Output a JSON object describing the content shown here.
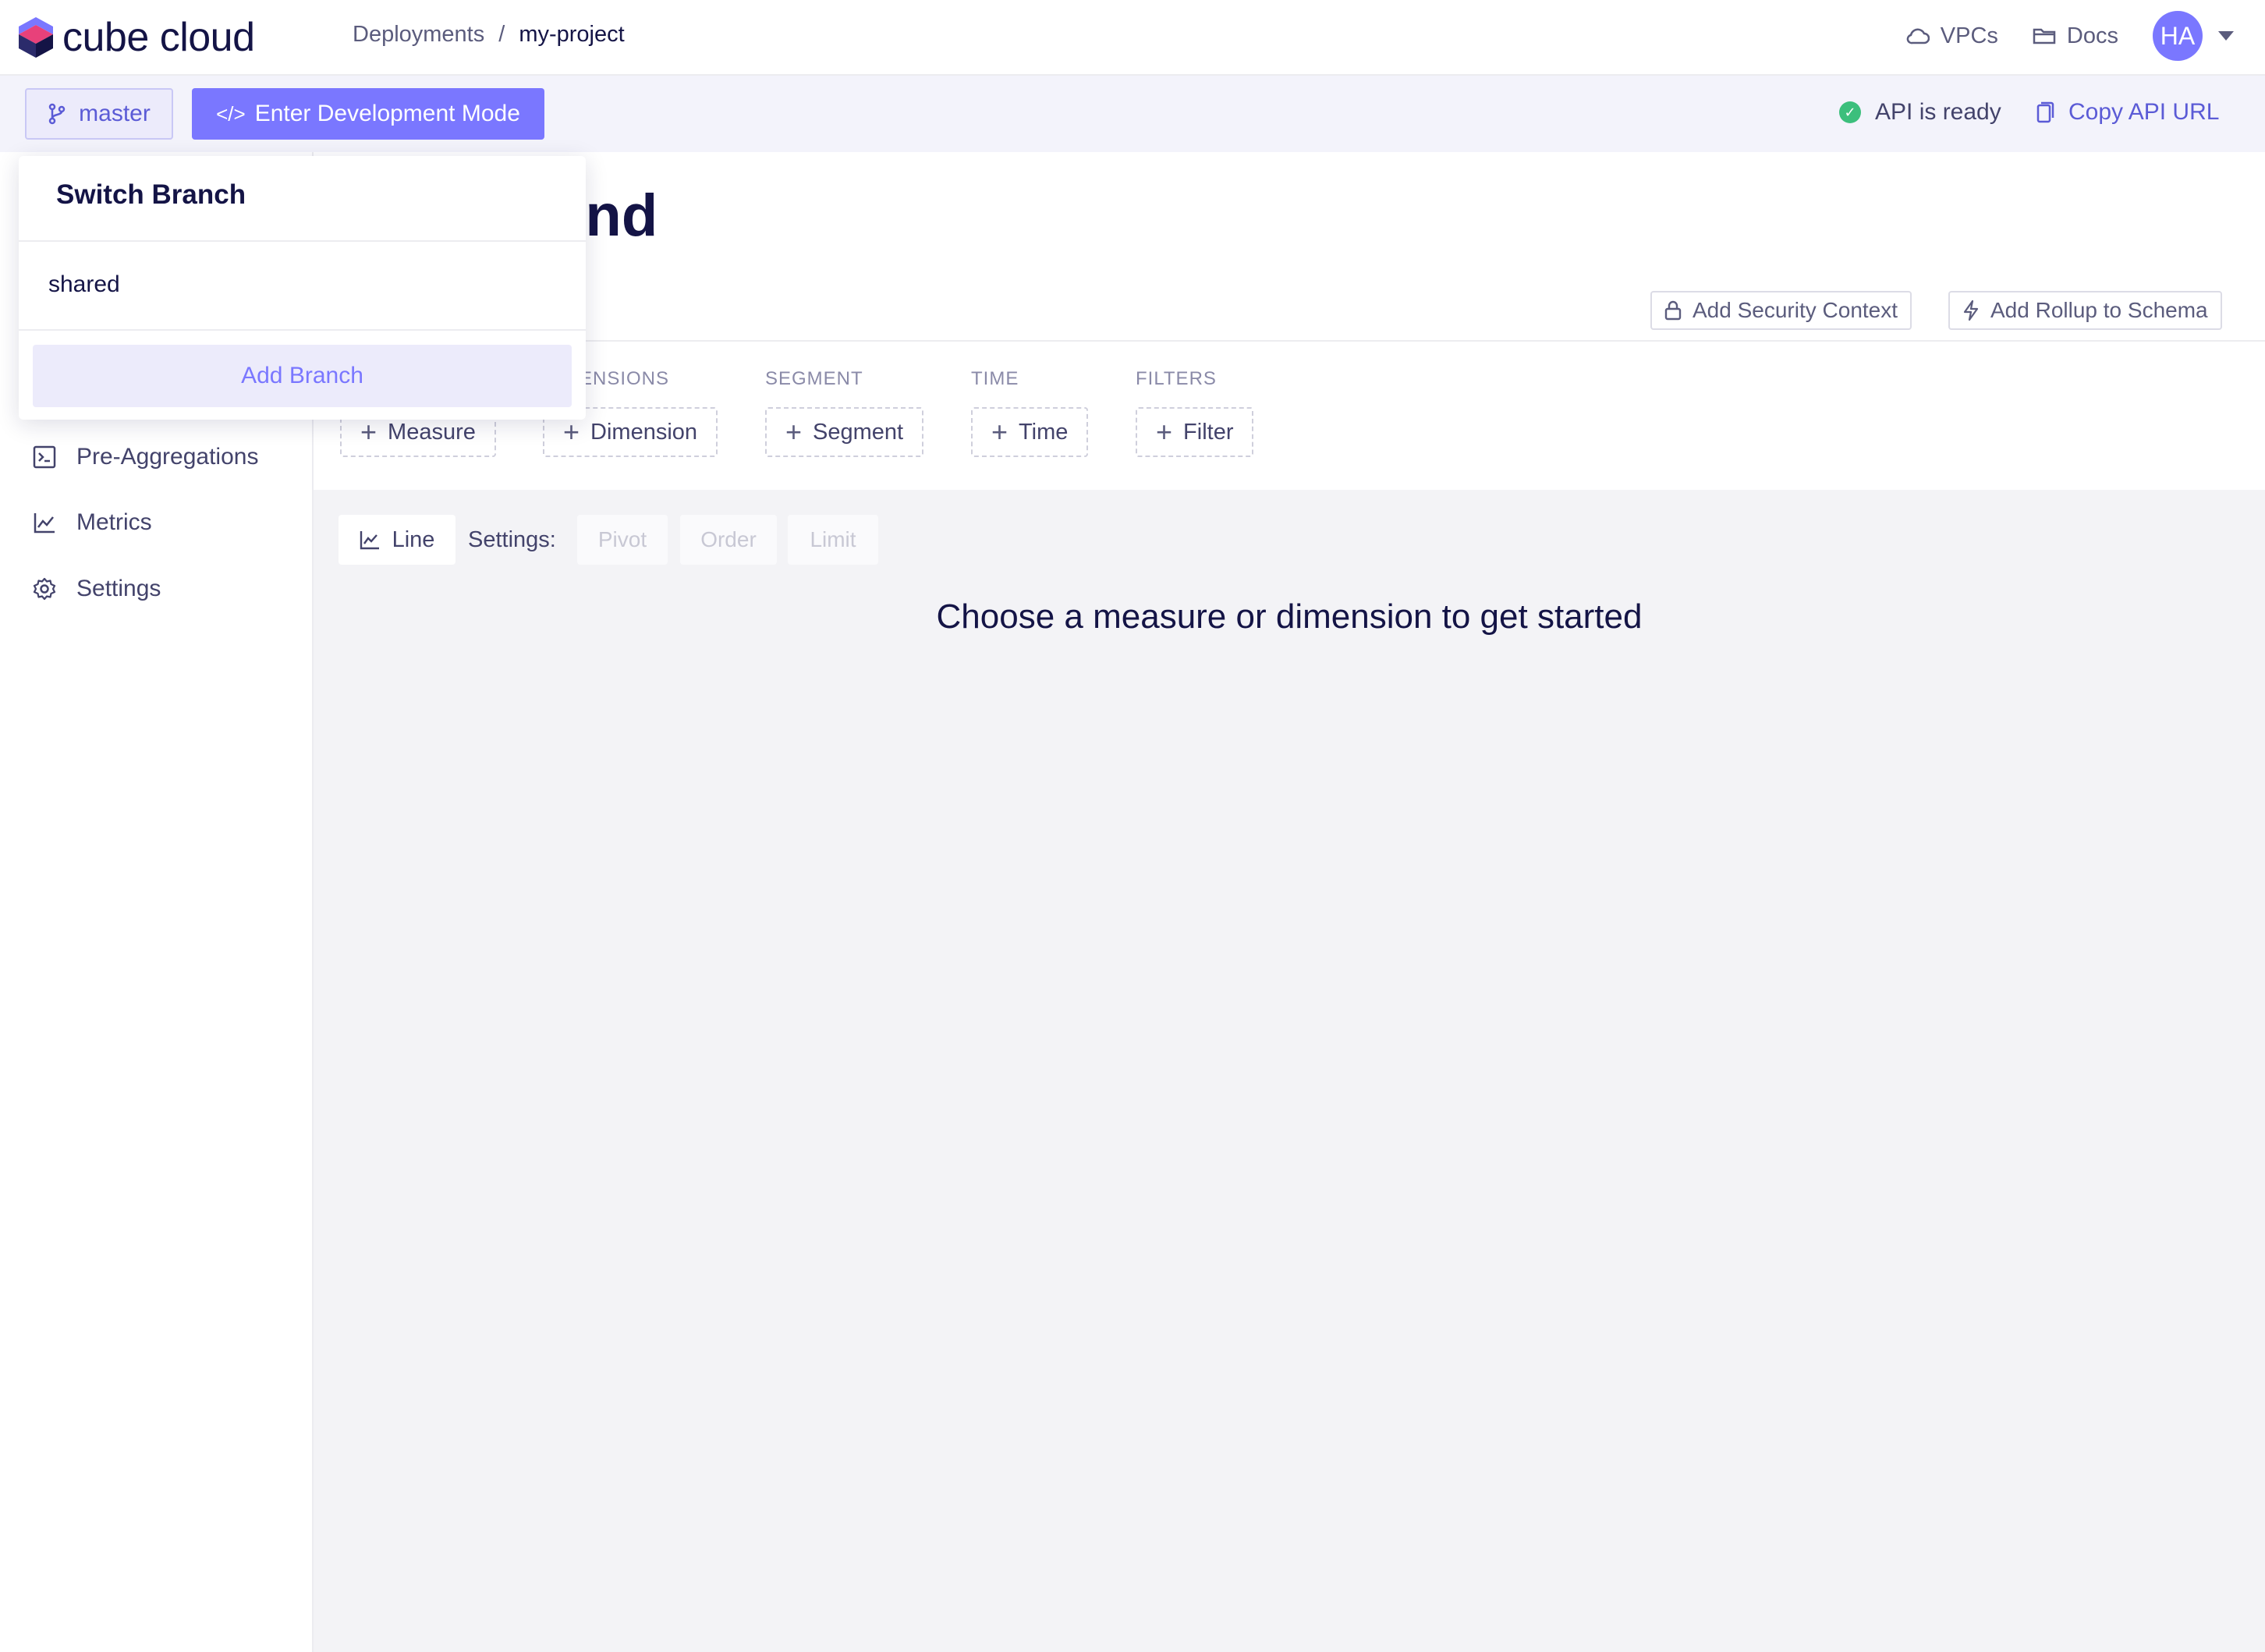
{
  "app": {
    "logo_text": "cube cloud"
  },
  "breadcrumb": {
    "parent": "Deployments",
    "separator": "/",
    "current": "my-project"
  },
  "topnav": {
    "vpcs_label": "VPCs",
    "docs_label": "Docs",
    "avatar_initials": "HA"
  },
  "subbar": {
    "branch_label": "master",
    "dev_mode_label": "Enter Development Mode",
    "dev_mode_icon": "</>",
    "api_status": "API is ready",
    "copy_api_label": "Copy API URL"
  },
  "sidebar": {
    "items": [
      {
        "label": "Pre-Aggregations",
        "icon": "terminal-icon"
      },
      {
        "label": "Metrics",
        "icon": "chart-line-icon"
      },
      {
        "label": "Settings",
        "icon": "gear-icon"
      }
    ]
  },
  "page": {
    "title_visible": "und",
    "add_security_context": "Add Security Context",
    "add_rollup": "Add Rollup to Schema"
  },
  "query": {
    "sections": [
      {
        "label": "",
        "button": "Measure"
      },
      {
        "label": "ENSIONS",
        "button": "Dimension"
      },
      {
        "label": "SEGMENT",
        "button": "Segment"
      },
      {
        "label": "TIME",
        "button": "Time"
      },
      {
        "label": "FILTERS",
        "button": "Filter"
      }
    ]
  },
  "results": {
    "chart_type_label": "Line",
    "settings_label": "Settings:",
    "settings_buttons": [
      "Pivot",
      "Order",
      "Limit"
    ],
    "empty_message": "Choose a measure or dimension to get started"
  },
  "branch_dropdown": {
    "title": "Switch Branch",
    "branches": [
      "shared"
    ],
    "add_branch_label": "Add Branch"
  },
  "colors": {
    "accent": "#7a77ff",
    "text_dark": "#141446",
    "status_ok": "#3cbf7c"
  }
}
